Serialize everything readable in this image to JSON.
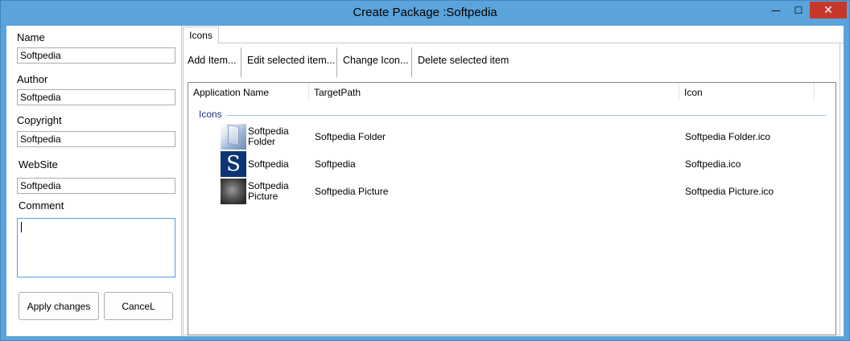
{
  "window": {
    "title": "Create Package :Softpedia",
    "minimize_glyph": "—",
    "maximize_glyph": "☐",
    "close_glyph": "✕"
  },
  "form": {
    "name_label": "Name",
    "name_value": "Softpedia",
    "author_label": "Author",
    "author_value": "Softpedia",
    "copyright_label": "Copyright",
    "copyright_value": "Softpedia",
    "website_label": "WebSite",
    "website_value": "Softpedia",
    "comment_label": "Comment",
    "comment_value": "",
    "apply_label": "Apply changes",
    "cancel_label": "CanceL"
  },
  "tabs": [
    {
      "label": "Icons"
    }
  ],
  "toolbar": {
    "add_label": "Add Item...",
    "edit_label": "Edit selected item...",
    "change_icon_label": "Change Icon...",
    "delete_label": "Delete selected item"
  },
  "list": {
    "columns": [
      "Application Name",
      "TargetPath",
      "Icon"
    ],
    "group": "Icons",
    "rows": [
      {
        "name_line1": "Softpedia",
        "name_line2": "Folder",
        "target": "Softpedia Folder",
        "icon": "Softpedia Folder.ico",
        "thumb": "folder-thumbnail",
        "thumb_text": ""
      },
      {
        "name_line1": "Softpedia",
        "name_line2": "",
        "target": "Softpedia",
        "icon": "Softpedia.ico",
        "thumb": "softpedia-logo-thumbnail",
        "thumb_text": "S"
      },
      {
        "name_line1": "Softpedia",
        "name_line2": "Picture",
        "target": "Softpedia Picture",
        "icon": "Softpedia Picture.ico",
        "thumb": "picture-thumbnail",
        "thumb_text": ""
      }
    ]
  }
}
